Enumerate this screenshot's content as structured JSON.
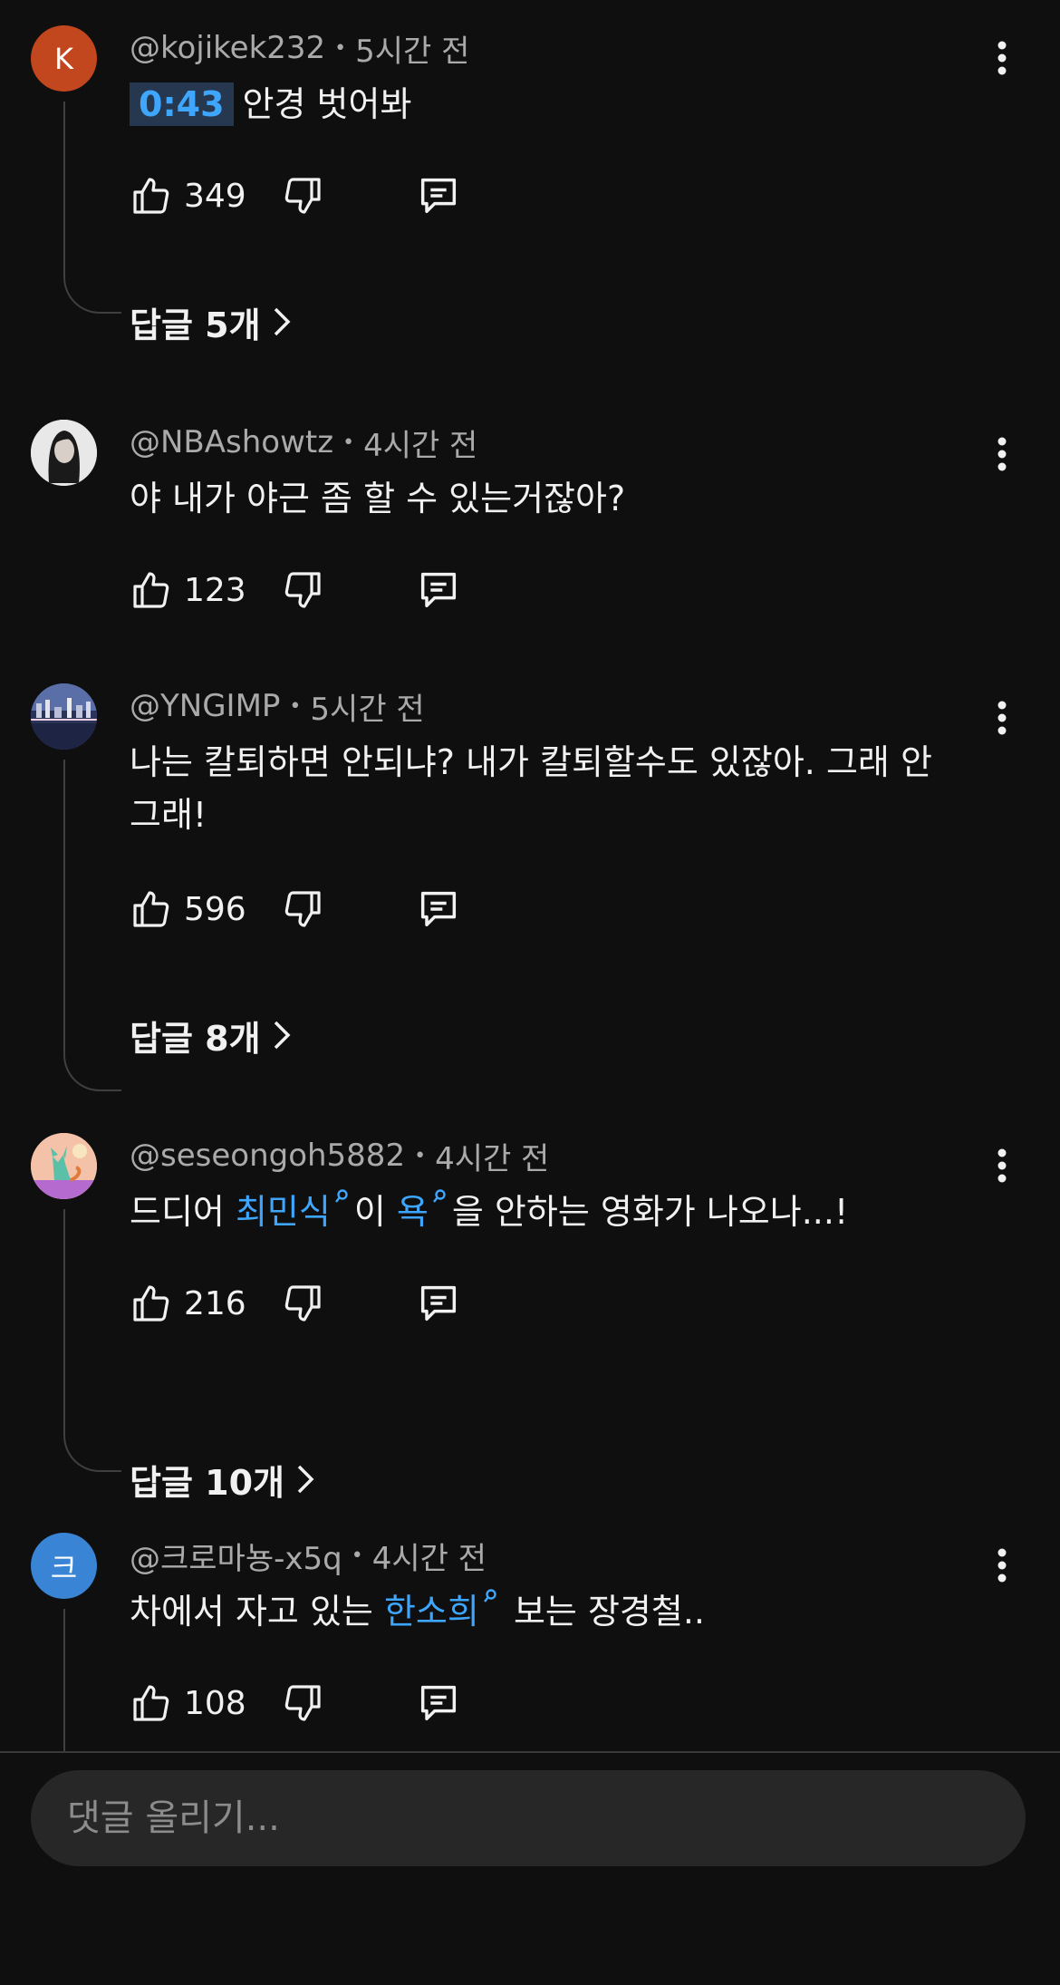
{
  "colors": {
    "background": "#0f0f0f",
    "link": "#3ea6ff",
    "secondary_text": "#aaaaaa"
  },
  "comments": [
    {
      "author": "@kojikek232",
      "time": "5시간 전",
      "avatar_letter": "K",
      "avatar_color": "#c2461e",
      "timestamp_link": "0:43",
      "text": "안경 벗어봐",
      "likes": "349",
      "replies": "답글 5개"
    },
    {
      "author": "@NBAshowtz",
      "time": "4시간 전",
      "avatar_letter": "",
      "avatar_color": "#e8e8e8",
      "text": "야 내가 야근 좀 할 수 있는거잖아?",
      "likes": "123",
      "replies": ""
    },
    {
      "author": "@YNGIMP",
      "time": "5시간 전",
      "avatar_letter": "",
      "avatar_color": "#3a4a7a",
      "text": "나는 칼퇴하면 안되냐? 내가 칼퇴할수도 있잖아. 그래 안 그래!",
      "likes": "596",
      "replies": "답글 8개"
    },
    {
      "author": "@seseongoh5882",
      "time": "4시간 전",
      "avatar_letter": "",
      "avatar_color": "#f2b6a0",
      "text_parts": [
        "드디어 ",
        "최민식",
        "이 ",
        "욕",
        "을 안하는 영화가 나오나...!"
      ],
      "likes": "216",
      "replies": "답글 10개"
    },
    {
      "author": "@크로마뇽-x5q",
      "time": "4시간 전",
      "avatar_letter": "크",
      "avatar_color": "#3a84d6",
      "text_parts": [
        "차에서 자고 있는 ",
        "한소희",
        " 보는 장경철.."
      ],
      "likes": "108",
      "replies": ""
    }
  ],
  "icons": [
    "thumbs-up-icon",
    "thumbs-down-icon",
    "reply-icon",
    "more-vert-icon",
    "chevron-right-icon",
    "search-mini-icon"
  ],
  "composer": {
    "placeholder": "댓글 올리기..."
  }
}
